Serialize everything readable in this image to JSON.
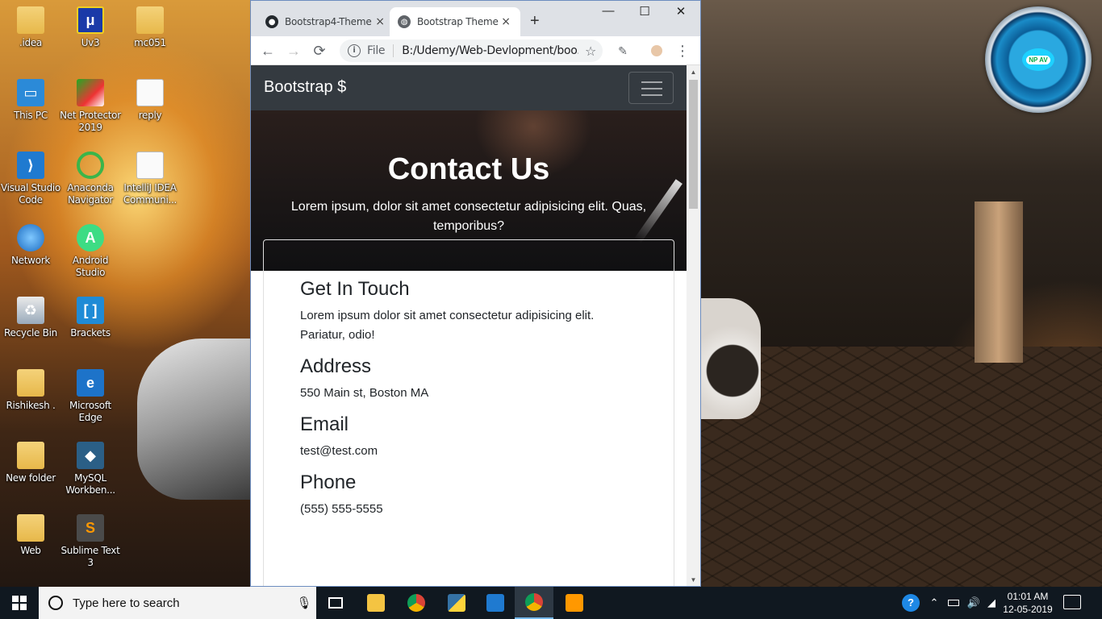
{
  "desktop": {
    "icons": [
      {
        "label": ".idea"
      },
      {
        "label": "Uv3"
      },
      {
        "label": "mc051"
      },
      {
        "label": "This PC"
      },
      {
        "label": "Net Protector 2019"
      },
      {
        "label": "reply"
      },
      {
        "label": "Visual Studio Code"
      },
      {
        "label": "Anaconda Navigator"
      },
      {
        "label": "IntelliJ IDEA Communi..."
      },
      {
        "label": "Network"
      },
      {
        "label": "Android Studio"
      },
      {
        "label": "Recycle Bin"
      },
      {
        "label": "Brackets"
      },
      {
        "label": "Rishikesh ."
      },
      {
        "label": "Microsoft Edge"
      },
      {
        "label": "New folder"
      },
      {
        "label": "MySQL Workben..."
      },
      {
        "label": "Web"
      },
      {
        "label": "Sublime Text 3"
      }
    ]
  },
  "npav": {
    "badge": "NP AV"
  },
  "browser": {
    "tabs": [
      {
        "title": "Bootstrap4-Theme",
        "close": "×"
      },
      {
        "title": "Bootstrap Theme",
        "close": "×"
      }
    ],
    "new_tab": "+",
    "controls": {
      "minimize": "—",
      "maximize": "☐",
      "close": "✕"
    },
    "nav": {
      "back": "←",
      "forward": "→",
      "reload": "⟳",
      "menu": "⋮"
    },
    "omnibox": {
      "info": "i",
      "scheme": "File",
      "url": "B:/Udemy/Web-Devlopment/boo...",
      "star": "☆"
    }
  },
  "page": {
    "navbar": {
      "brand": "Bootstrap $"
    },
    "hero": {
      "title": "Contact Us",
      "subtitle": "Lorem ipsum, dolor sit amet consectetur adipisicing elit. Quas, temporibus?"
    },
    "contact": {
      "heading": "Get In Touch",
      "intro": "Lorem ipsum dolor sit amet consectetur adipisicing elit. Pariatur, odio!",
      "address_heading": "Address",
      "address": "550 Main st, Boston MA",
      "email_heading": "Email",
      "email": "test@test.com",
      "phone_heading": "Phone",
      "phone": "(555) 555-5555"
    }
  },
  "taskbar": {
    "search_placeholder": "Type here to search",
    "clock_time": "01:01 AM",
    "clock_date": "12-05-2019",
    "help": "?"
  },
  "colors": {
    "navbar": "#343a40",
    "taskbar": "#101820",
    "tab_strip": "#dee1e6"
  }
}
